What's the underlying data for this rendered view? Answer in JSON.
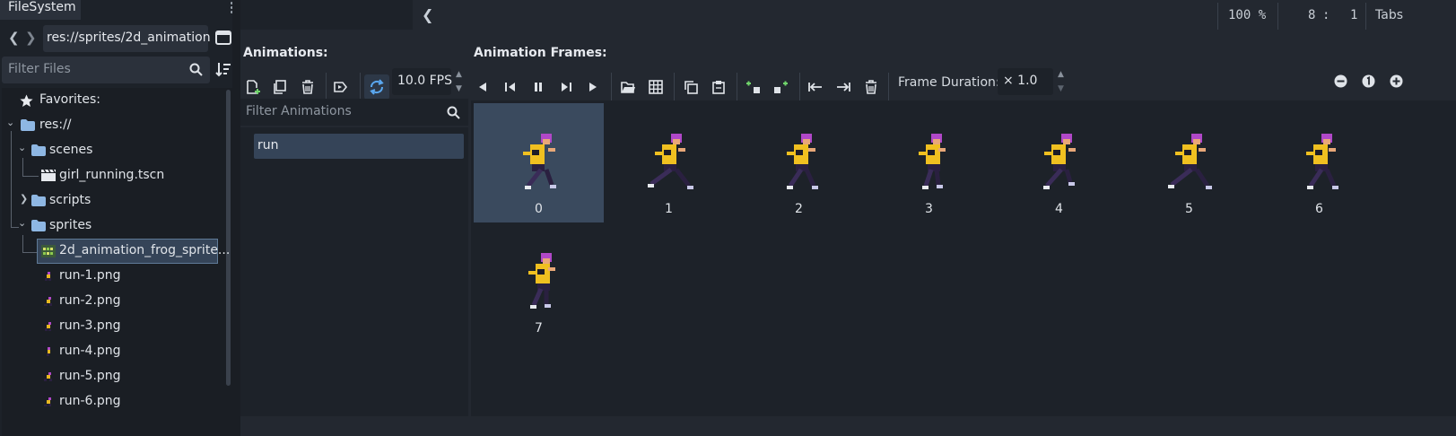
{
  "filesystem": {
    "tab_label": "FileSystem",
    "path": "res://sprites/2d_animation",
    "filter_placeholder": "Filter Files",
    "favorites_label": "Favorites:",
    "tree": {
      "root": "res://",
      "scenes": "scenes",
      "girl_scene": "girl_running.tscn",
      "scripts": "scripts",
      "sprites": "sprites",
      "spritesheet": "2d_animation_frog_sprite...",
      "run1": "run-1.png",
      "run2": "run-2.png",
      "run3": "run-3.png",
      "run4": "run-4.png",
      "run5": "run-5.png",
      "run6": "run-6.png"
    }
  },
  "topbar": {
    "zoom": "100 %",
    "line": "8",
    "col": "1",
    "indent": "Tabs"
  },
  "animations": {
    "title": "Animations:",
    "fps": "10.0 FPS",
    "filter_placeholder": "Filter Animations",
    "items": [
      "run"
    ]
  },
  "frames": {
    "title": "Animation Frames:",
    "duration_label": "Frame Duration:",
    "duration_value": "× 1.0",
    "labels": [
      "0",
      "1",
      "2",
      "3",
      "4",
      "5",
      "6",
      "7"
    ],
    "selected_index": 0
  },
  "colors": {
    "accent": "#3f8fd8",
    "selection": "#354458",
    "panel": "#232830"
  }
}
